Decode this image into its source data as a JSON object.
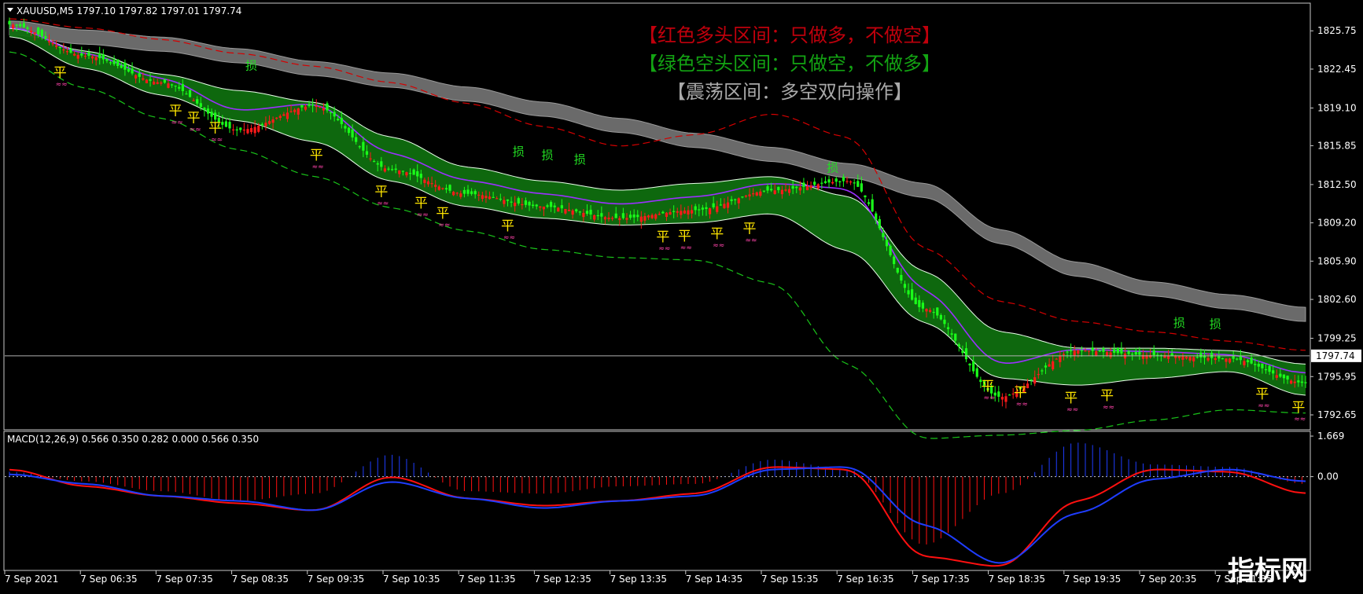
{
  "window": {
    "symbol_line": "XAUUSD,M5  1797.10 1797.82 1797.01 1797.74",
    "dropdown_icon": "triangle-down-icon"
  },
  "legend_notes": [
    {
      "text": "【红色多头区间：只做多，不做空】",
      "color": "#c0000c"
    },
    {
      "text": "【绿色空头区间：只做空，不做多】",
      "color": "#13a313"
    },
    {
      "text": "【震荡区间：多空双向操作】",
      "color": "#a9a9a9"
    }
  ],
  "price_axis": {
    "ticks": [
      "1825.75",
      "1822.45",
      "1819.10",
      "1815.85",
      "1812.50",
      "1809.20",
      "1805.90",
      "1802.60",
      "1799.25",
      "1795.95",
      "1792.65"
    ],
    "current_price": "1797.74",
    "ylim": [
      1791.5,
      1828.0
    ]
  },
  "macd": {
    "label": "MACD(12,26,9) 0.566 0.350 0.282 0.000 0.566 0.350",
    "ticks": [
      "1.669",
      "0.00"
    ],
    "ylim": [
      -3.8,
      1.8
    ]
  },
  "time_axis": {
    "labels": [
      "7 Sep 2021",
      "7 Sep 06:35",
      "7 Sep 07:35",
      "7 Sep 08:35",
      "7 Sep 09:35",
      "7 Sep 10:35",
      "7 Sep 11:35",
      "7 Sep 12:35",
      "7 Sep 13:35",
      "7 Sep 14:35",
      "7 Sep 15:35",
      "7 Sep 16:35",
      "7 Sep 17:35",
      "7 Sep 18:35",
      "7 Sep 19:35",
      "7 Sep 20:35",
      "7 Sep 21:35"
    ]
  },
  "chart_data": {
    "type": "line",
    "x_index": [
      0,
      12,
      24,
      36,
      48,
      60,
      72,
      84,
      96,
      108,
      120,
      132,
      144,
      156,
      168,
      180,
      192,
      204
    ],
    "series_price": [
      1826.3,
      1823.6,
      1821.3,
      1817.2,
      1819.3,
      1813.8,
      1811.7,
      1810.6,
      1809.6,
      1810.3,
      1812.0,
      1812.8,
      1801.8,
      1794.2,
      1798.2,
      1797.8,
      1797.5,
      1795.4
    ],
    "series_band_upper": [
      1826.0,
      1824.0,
      1822.0,
      1820.6,
      1819.6,
      1816.6,
      1814.0,
      1812.8,
      1812.0,
      1812.6,
      1813.2,
      1811.5,
      1805.0,
      1799.8,
      1798.4,
      1798.4,
      1798.2,
      1797.0
    ],
    "series_band_lower": [
      1825.3,
      1822.5,
      1820.2,
      1818.0,
      1816.2,
      1812.8,
      1810.6,
      1809.6,
      1809.0,
      1809.2,
      1810.0,
      1806.8,
      1800.6,
      1795.8,
      1795.2,
      1795.8,
      1796.4,
      1794.3
    ],
    "series_ma_gray": [
      1826.0,
      1825.2,
      1824.6,
      1823.6,
      1822.5,
      1821.5,
      1820.3,
      1819.0,
      1817.6,
      1816.3,
      1815.1,
      1813.7,
      1812.0,
      1808.0,
      1805.2,
      1803.5,
      1802.4,
      1801.3
    ],
    "series_red_dashed": [
      1826.8,
      1826.0,
      1825.0,
      1823.8,
      1822.7,
      1821.3,
      1819.5,
      1817.5,
      1815.8,
      1816.8,
      1818.6,
      1816.6,
      1807.0,
      1802.4,
      1800.7,
      1799.8,
      1799.0,
      1798.2
    ],
    "series_green_dashed": [
      1824.0,
      1820.8,
      1818.2,
      1815.5,
      1813.2,
      1810.5,
      1808.5,
      1806.9,
      1806.2,
      1806.0,
      1804.0,
      1797.0,
      1790.6,
      1790.9,
      1791.3,
      1792.2,
      1793.1,
      1792.8
    ],
    "macd_histogram": [
      0.2,
      -0.2,
      -0.6,
      -1.0,
      -0.7,
      0.9,
      -0.6,
      -0.7,
      -0.4,
      -0.3,
      0.7,
      0.3,
      -2.8,
      -0.7,
      1.4,
      0.5,
      0.4,
      -0.3
    ],
    "macd_signal": [
      0.3,
      -0.4,
      -0.8,
      -1.1,
      -1.4,
      0.0,
      -0.9,
      -1.2,
      -1.0,
      -0.7,
      0.4,
      0.3,
      -3.3,
      -3.7,
      -1.0,
      0.3,
      0.2,
      -0.7
    ],
    "macd_line": [
      0.1,
      -0.3,
      -0.8,
      -1.0,
      -1.4,
      -0.2,
      -0.9,
      -1.3,
      -1.0,
      -0.8,
      0.3,
      0.4,
      -2.0,
      -3.6,
      -1.5,
      -0.1,
      0.3,
      -0.2
    ],
    "markers": [
      {
        "i": 14,
        "text": "平",
        "type": "flat"
      },
      {
        "i": 46,
        "text": "平",
        "type": "flat"
      },
      {
        "i": 51,
        "text": "平",
        "type": "flat"
      },
      {
        "i": 57,
        "text": "平",
        "type": "flat"
      },
      {
        "i": 85,
        "text": "平",
        "type": "flat"
      },
      {
        "i": 103,
        "text": "平",
        "type": "flat"
      },
      {
        "i": 114,
        "text": "平",
        "type": "flat"
      },
      {
        "i": 120,
        "text": "平",
        "type": "flat"
      },
      {
        "i": 138,
        "text": "平",
        "type": "flat"
      },
      {
        "i": 181,
        "text": "平",
        "type": "flat"
      },
      {
        "i": 187,
        "text": "平",
        "type": "flat"
      },
      {
        "i": 196,
        "text": "平",
        "type": "flat"
      },
      {
        "i": 205,
        "text": "平",
        "type": "flat"
      },
      {
        "i": 271,
        "text": "平",
        "type": "flat"
      },
      {
        "i": 280,
        "text": "平",
        "type": "flat"
      },
      {
        "i": 294,
        "text": "平",
        "type": "flat"
      },
      {
        "i": 304,
        "text": "平",
        "type": "flat"
      },
      {
        "i": 347,
        "text": "平",
        "type": "flat"
      },
      {
        "i": 357,
        "text": "平",
        "type": "flat"
      },
      {
        "i": 67,
        "text": "损",
        "type": "stop"
      },
      {
        "i": 141,
        "text": "损",
        "type": "stop"
      },
      {
        "i": 149,
        "text": "损",
        "type": "stop"
      },
      {
        "i": 158,
        "text": "损",
        "type": "stop"
      },
      {
        "i": 228,
        "text": "损",
        "type": "stop"
      },
      {
        "i": 324,
        "text": "损",
        "type": "stop"
      },
      {
        "i": 334,
        "text": "损",
        "type": "stop"
      }
    ]
  },
  "colors": {
    "bull": "#ff1a1a",
    "bear": "#1aff1a",
    "band_fill": "#0f6e0f",
    "band_edge": "#e8ffe8",
    "gray_ribbon": "#6a6a6a",
    "red_dash": "#d40000",
    "green_dash": "#19c419",
    "purple": "#9b30ff",
    "macd_blue": "#1f3dff",
    "macd_red": "#ff1010"
  },
  "watermark": "指标网"
}
